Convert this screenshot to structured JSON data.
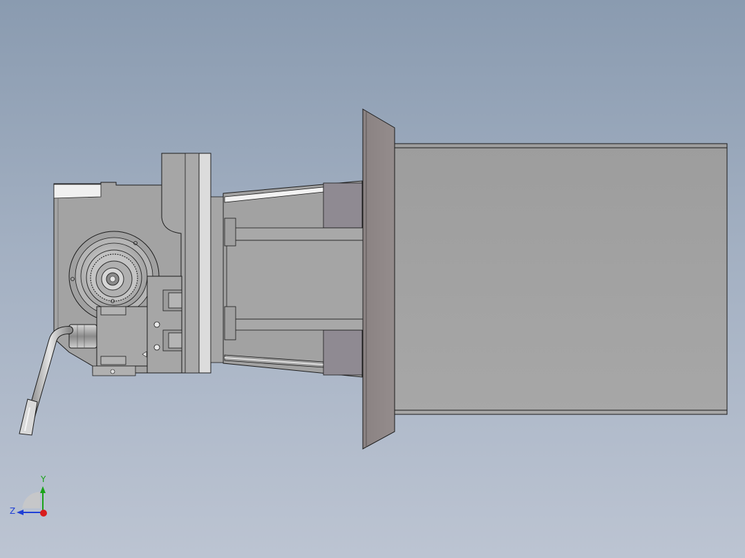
{
  "viewport": {
    "background_top": "#8a9bb0",
    "background_bottom": "#bcc4d2"
  },
  "triad": {
    "y_label": "Y",
    "z_label": "Z",
    "y_color": "#19a319",
    "z_color": "#1f3fd6",
    "x_color": "#d81c1c"
  },
  "model": {
    "body_color": "#a3a3a3",
    "edge_color": "#1a1a1a",
    "flange_color": "#8e8686"
  }
}
